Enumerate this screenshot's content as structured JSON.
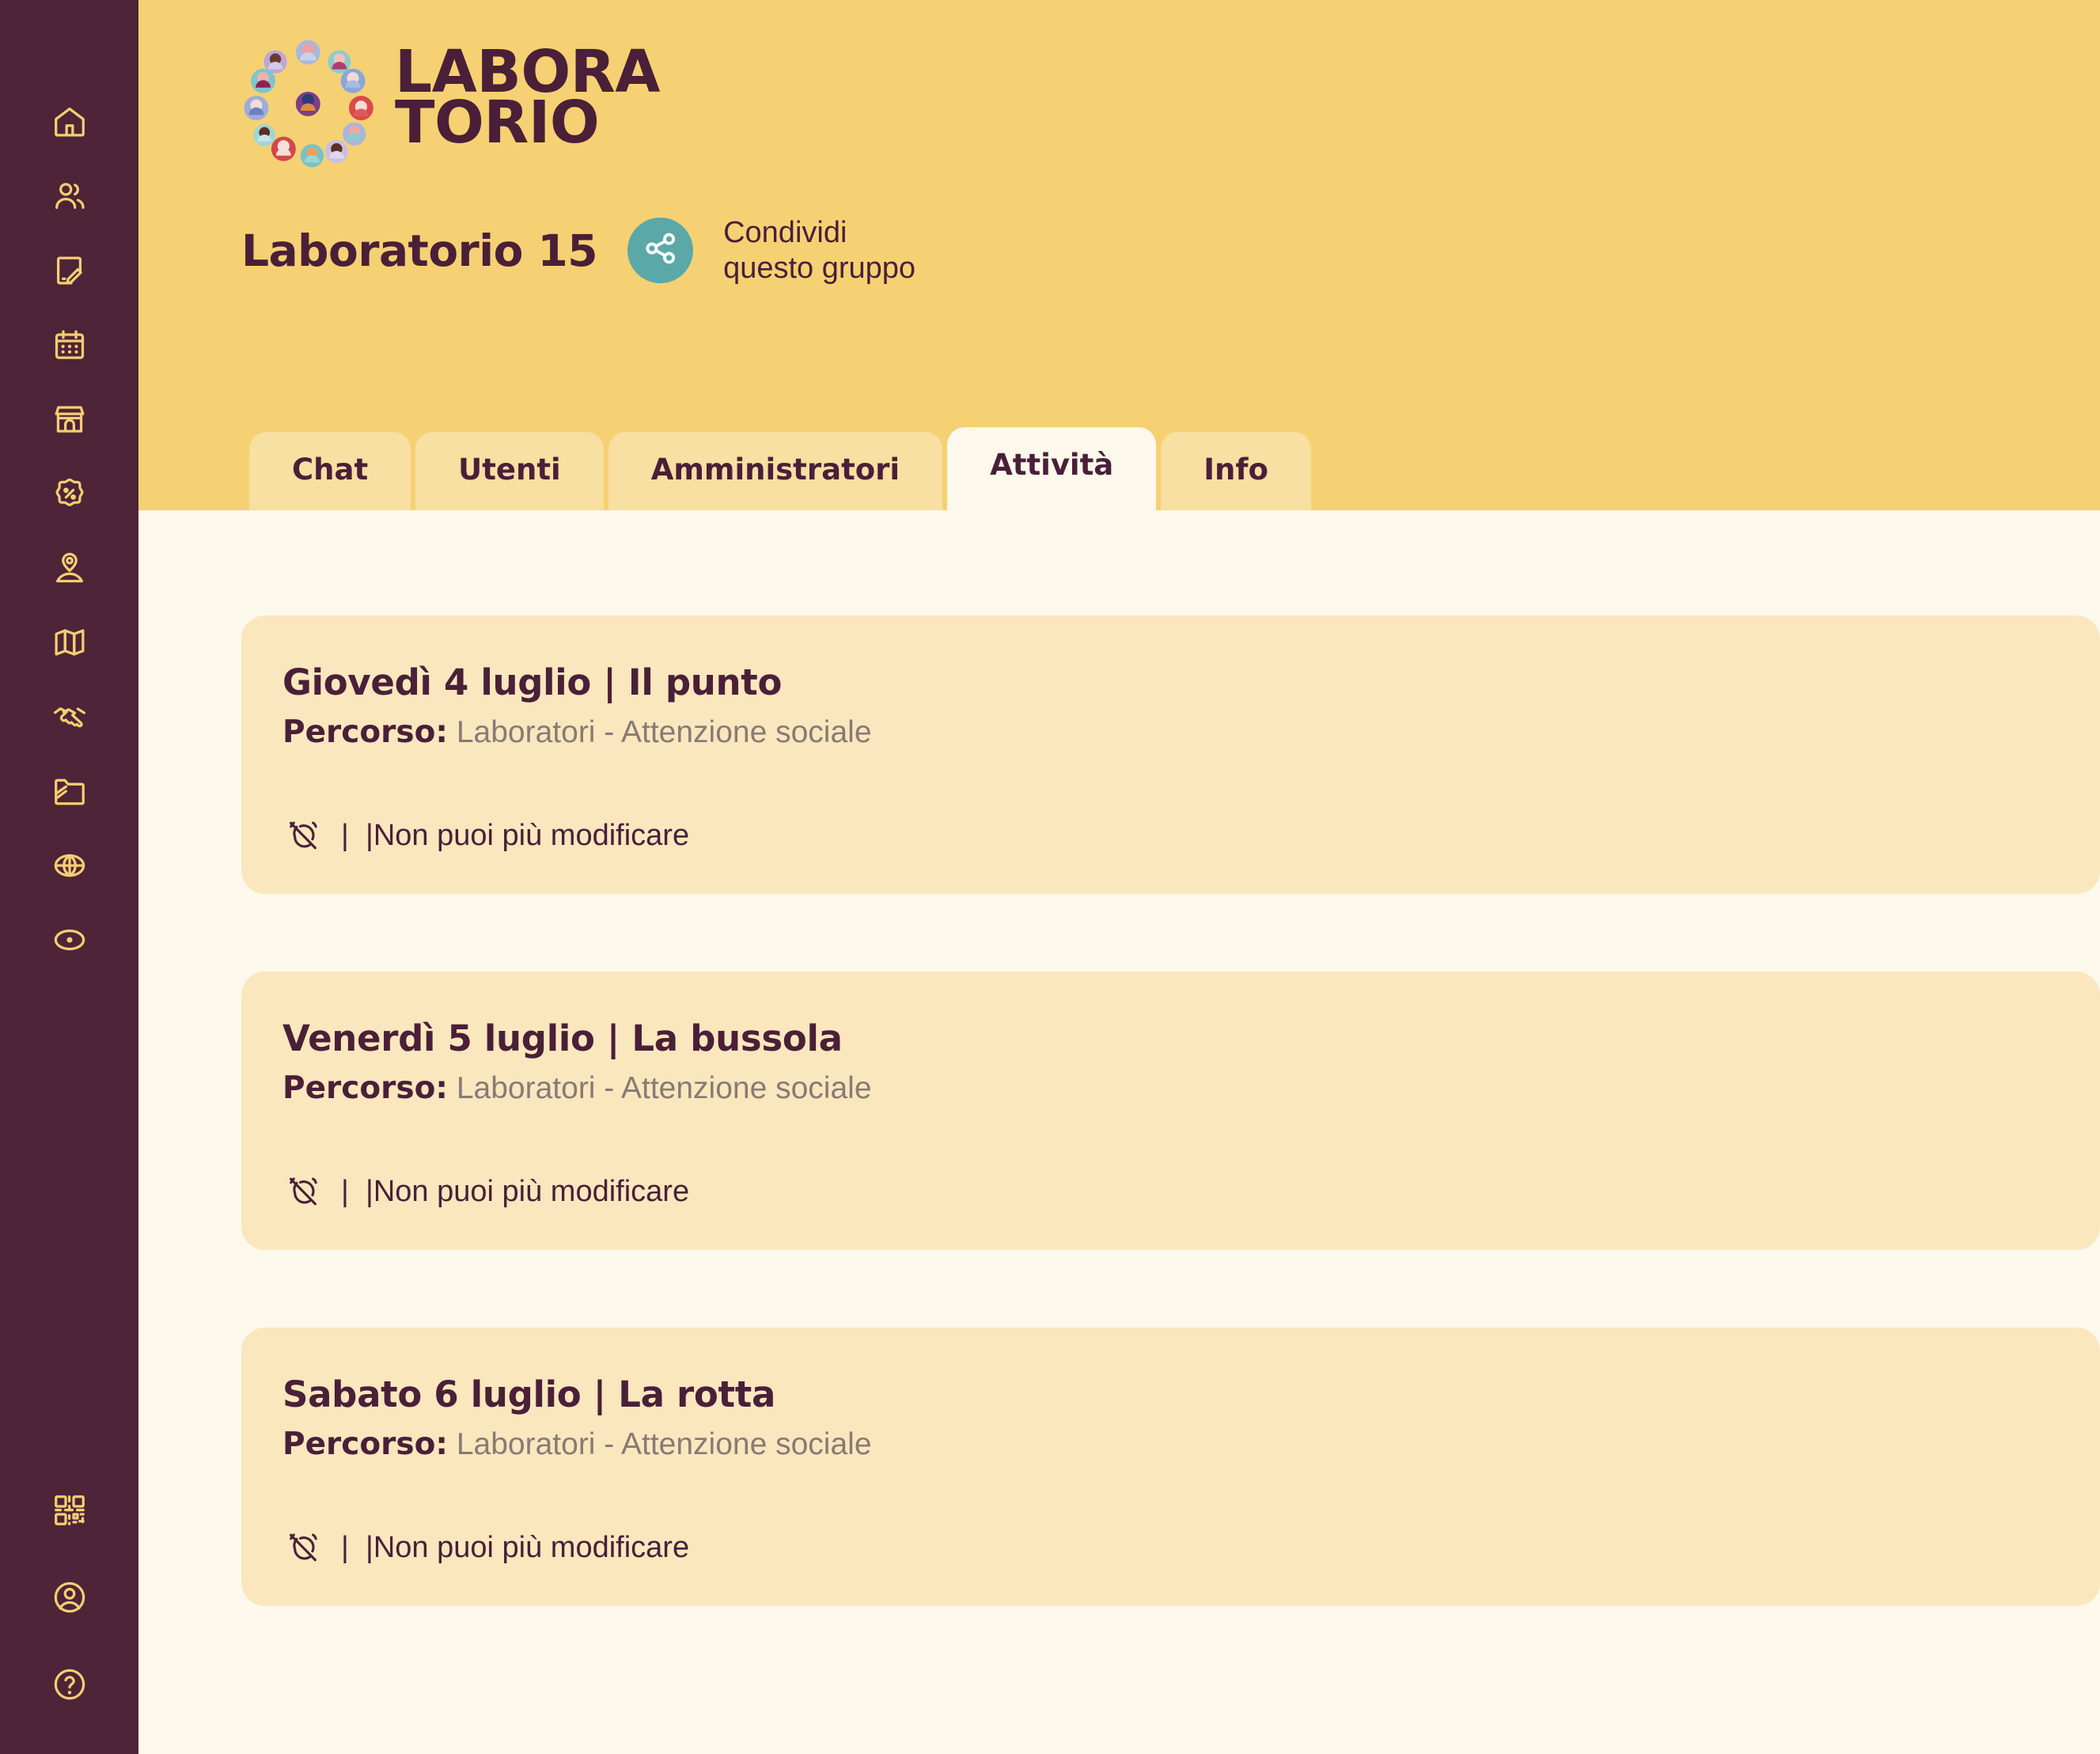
{
  "colors": {
    "sidebar_bg": "#4D2438",
    "sidebar_icon": "#F5CE72",
    "header_bg": "#F5D173",
    "content_bg": "#FDF8EC",
    "card_bg": "#FAE7BE",
    "tab_inactive_bg": "#F8DFA2",
    "tab_active_bg": "#FDF8EC",
    "accent_text": "#4A1F38",
    "muted_text": "#8A7A74",
    "share_circle": "#5BA8A8"
  },
  "sidebar": {
    "top_items": [
      {
        "name": "home-icon",
        "label": "Home"
      },
      {
        "name": "users-icon",
        "label": "Utenti"
      },
      {
        "name": "edit-document-icon",
        "label": "Documenti"
      },
      {
        "name": "calendar-icon",
        "label": "Calendario"
      },
      {
        "name": "store-icon",
        "label": "Negozio"
      },
      {
        "name": "discount-icon",
        "label": "Offerte"
      },
      {
        "name": "person-pin-icon",
        "label": "Profilo luogo"
      },
      {
        "name": "map-icon",
        "label": "Mappa"
      },
      {
        "name": "handshake-icon",
        "label": "Collaborazioni"
      },
      {
        "name": "folder-edit-icon",
        "label": "Cartelle"
      },
      {
        "name": "globe-icon",
        "label": "Rete"
      },
      {
        "name": "record-icon",
        "label": "Registrazioni"
      }
    ],
    "bottom_items": [
      {
        "name": "qr-code-icon",
        "label": "QR Code"
      },
      {
        "name": "account-circle-icon",
        "label": "Account"
      },
      {
        "name": "help-circle-icon",
        "label": "Aiuto"
      }
    ]
  },
  "header": {
    "logo_line1": "LABORA",
    "logo_line2": "TORIO",
    "group_title": "Laboratorio 15",
    "share_icon": "share-icon",
    "share_line1": "Condividi",
    "share_line2": "questo gruppo"
  },
  "tabs": [
    {
      "label": "Chat",
      "active": false
    },
    {
      "label": "Utenti",
      "active": false
    },
    {
      "label": "Amministratori",
      "active": false
    },
    {
      "label": "Attività",
      "active": true
    },
    {
      "label": "Info",
      "active": false
    }
  ],
  "activities": [
    {
      "title": "Giovedì 4 luglio | Il punto",
      "percorso_label": "Percorso:",
      "percorso_value": " Laboratori - Attenzione sociale",
      "status_icon": "alarm-off-icon",
      "status_text": "|  |Non puoi più modificare"
    },
    {
      "title": "Venerdì 5 luglio | La bussola",
      "percorso_label": "Percorso:",
      "percorso_value": " Laboratori - Attenzione sociale",
      "status_icon": "alarm-off-icon",
      "status_text": "|  |Non puoi più modificare"
    },
    {
      "title": "Sabato 6 luglio | La rotta",
      "percorso_label": "Percorso:",
      "percorso_value": " Laboratori - Attenzione sociale",
      "status_icon": "alarm-off-icon",
      "status_text": "|  |Non puoi più modificare"
    }
  ]
}
